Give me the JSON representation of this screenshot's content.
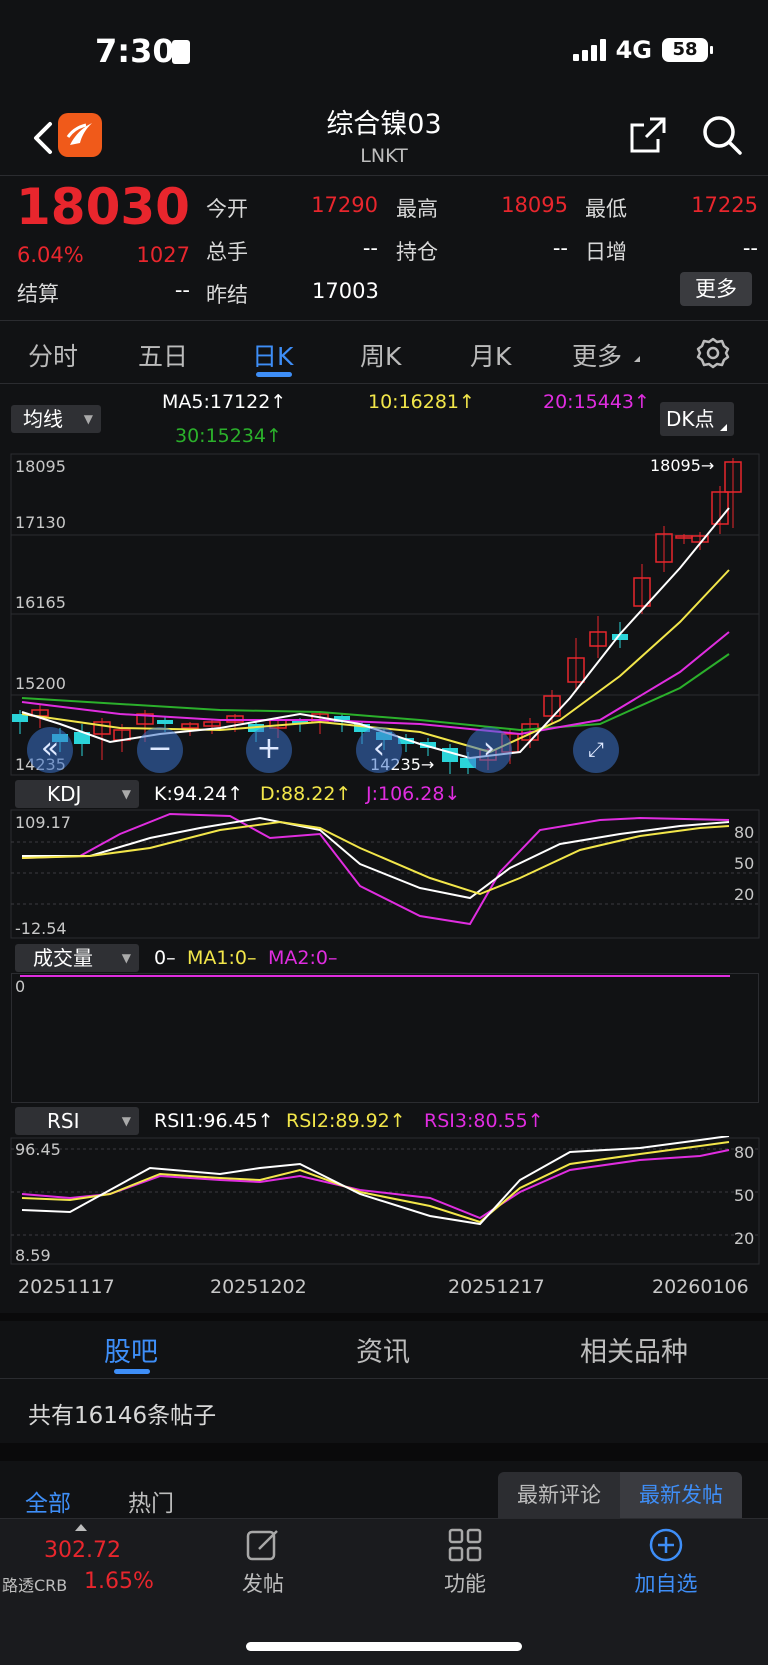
{
  "status": {
    "time": "7:30",
    "network": "4G",
    "battery": "58"
  },
  "header": {
    "title": "综合镍03",
    "code": "LNKT"
  },
  "quote": {
    "price": "18030",
    "change_pct": "6.04%",
    "change": "1027",
    "open_label": "今开",
    "open": "17290",
    "high_label": "最高",
    "high": "18095",
    "low_label": "最低",
    "low": "17225",
    "volume_label": "总手",
    "volume": "--",
    "oi_label": "持仓",
    "oi": "--",
    "daily_inc_label": "日增",
    "daily_inc": "--",
    "settle_label": "结算",
    "settle": "--",
    "prev_settle_label": "昨结",
    "prev_settle": "17003",
    "more_button": "更多"
  },
  "tabs": [
    "分时",
    "五日",
    "日K",
    "周K",
    "月K",
    "更多"
  ],
  "active_tab": "日K",
  "ma": {
    "selector": "均线",
    "ma5": "MA5:17122↑",
    "ma10": "10:16281↑",
    "ma20": "20:15443↑",
    "ma30": "30:15234↑",
    "dk_button": "DK点"
  },
  "kline": {
    "y_labels": [
      "18095",
      "17130",
      "16165",
      "15200",
      "14235"
    ],
    "high_marker": "18095→",
    "low_marker": "14235→"
  },
  "kdj": {
    "selector": "KDJ",
    "k": "K:94.24↑",
    "d": "D:88.22↑",
    "j": "J:106.28↓",
    "y_top": "109.17",
    "y_bottom": "-12.54",
    "levels": [
      "80",
      "50",
      "20"
    ]
  },
  "volume_panel": {
    "selector": "成交量",
    "v": "0–",
    "ma1": "MA1:0–",
    "ma2": "MA2:0–",
    "y_label": "0"
  },
  "rsi": {
    "selector": "RSI",
    "rsi1": "RSI1:96.45↑",
    "rsi2": "RSI2:89.92↑",
    "rsi3": "RSI3:80.55↑",
    "y_top": "96.45",
    "y_bottom": "8.59",
    "levels": [
      "80",
      "50",
      "20"
    ]
  },
  "dates": [
    "20251117",
    "20251202",
    "20251217",
    "20260106"
  ],
  "section_tabs": [
    "股吧",
    "资讯",
    "相关品种"
  ],
  "post_count": "共有16146条帖子",
  "filter_tabs": [
    "全部",
    "热门"
  ],
  "sort_buttons": [
    "最新评论",
    "最新发帖"
  ],
  "bottom_nav": {
    "index_value": "302.72",
    "index_name": "路透CRB",
    "index_change": "1.65%",
    "items": [
      "发帖",
      "功能",
      "加自选"
    ]
  },
  "colors": {
    "up": "#e8262d",
    "down": "#2bd4d9",
    "accent": "#3e8ef7",
    "ma5": "#ffffff",
    "ma10": "#f2e64a",
    "ma20": "#e02de0",
    "ma30": "#2bb02b"
  }
}
